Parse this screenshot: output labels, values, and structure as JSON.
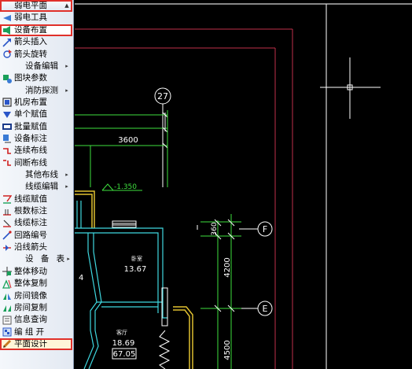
{
  "menu": {
    "items": [
      {
        "label": "弱电平面",
        "icon": "none",
        "arrow": "▲",
        "style": "head"
      },
      {
        "label": "弱电工具",
        "icon": "triangle-icon",
        "arrow": "",
        "style": "item"
      },
      {
        "label": "设备布置",
        "icon": "speaker-icon",
        "arrow": "",
        "style": "item"
      },
      {
        "label": "箭头插入",
        "icon": "arrow-insert-icon",
        "arrow": "",
        "style": "item"
      },
      {
        "label": "箭头旋转",
        "icon": "arrow-rotate-icon",
        "arrow": "",
        "style": "item"
      },
      {
        "label": "设备编辑",
        "icon": "none",
        "arrow": "▸",
        "style": "sub"
      },
      {
        "label": "图块参数",
        "icon": "block-param-icon",
        "arrow": "",
        "style": "item"
      },
      {
        "label": "消防探测",
        "icon": "none",
        "arrow": "▸",
        "style": "sub"
      },
      {
        "label": "机房布置",
        "icon": "room-layout-icon",
        "arrow": "",
        "style": "item"
      },
      {
        "label": "单个赋值",
        "icon": "single-assign-icon",
        "arrow": "",
        "style": "item"
      },
      {
        "label": "批量赋值",
        "icon": "batch-assign-icon",
        "arrow": "",
        "style": "item"
      },
      {
        "label": "设备标注",
        "icon": "device-label-icon",
        "arrow": "",
        "style": "item"
      },
      {
        "label": "连续布线",
        "icon": "continuous-wire-icon",
        "arrow": "",
        "style": "item"
      },
      {
        "label": "间断布线",
        "icon": "broken-wire-icon",
        "arrow": "",
        "style": "item"
      },
      {
        "label": "其他布线",
        "icon": "none",
        "arrow": "▸",
        "style": "sub"
      },
      {
        "label": "线缆编辑",
        "icon": "none",
        "arrow": "▸",
        "style": "sub"
      },
      {
        "label": "线缆赋值",
        "icon": "cable-assign-icon",
        "arrow": "",
        "style": "item"
      },
      {
        "label": "根数标注",
        "icon": "count-label-icon",
        "arrow": "",
        "style": "item"
      },
      {
        "label": "线缆标注",
        "icon": "cable-label-icon",
        "arrow": "",
        "style": "item"
      },
      {
        "label": "回路编号",
        "icon": "loop-number-icon",
        "arrow": "",
        "style": "item"
      },
      {
        "label": "沿线箭头",
        "icon": "along-arrow-icon",
        "arrow": "",
        "style": "item"
      },
      {
        "label": "设 备 表",
        "icon": "none",
        "arrow": "▸",
        "style": "sep"
      },
      {
        "label": "整体移动",
        "icon": "move-all-icon",
        "arrow": "",
        "style": "item"
      },
      {
        "label": "整体复制",
        "icon": "copy-all-icon",
        "arrow": "",
        "style": "item"
      },
      {
        "label": "房间镜像",
        "icon": "mirror-room-icon",
        "arrow": "",
        "style": "item"
      },
      {
        "label": "房间复制",
        "icon": "copy-room-icon",
        "arrow": "",
        "style": "item"
      },
      {
        "label": "信息查询",
        "icon": "info-query-icon",
        "arrow": "",
        "style": "item"
      },
      {
        "label": "编 组 开",
        "icon": "group-icon",
        "arrow": "",
        "style": "item"
      },
      {
        "label": "平面设计",
        "icon": "pencil-icon",
        "arrow": "",
        "style": "item"
      }
    ],
    "highlighted": [
      "弱电平面",
      "设备布置",
      "平面设计"
    ]
  },
  "drawing": {
    "axis_number": "27",
    "grid_f": "F",
    "grid_e": "E",
    "dim_3600": "3600",
    "dim_360": "360",
    "dim_4200": "4200",
    "dim_4500": "4500",
    "elevation": "-1.350",
    "room1_name": "卧室",
    "room1_area": "13.67",
    "room2_name": "客厅",
    "room2_area": "18.69",
    "room2_box": "67.05",
    "left_dim": "4"
  },
  "colors": {
    "menu_highlight": "#e0302a",
    "cad_background": "#000000",
    "border_red": "#c0304a",
    "wall_cyan": "#3fd8e0",
    "dim_green": "#3ee03e",
    "wire_yellow": "#e0c030",
    "text_white": "#ffffff"
  }
}
